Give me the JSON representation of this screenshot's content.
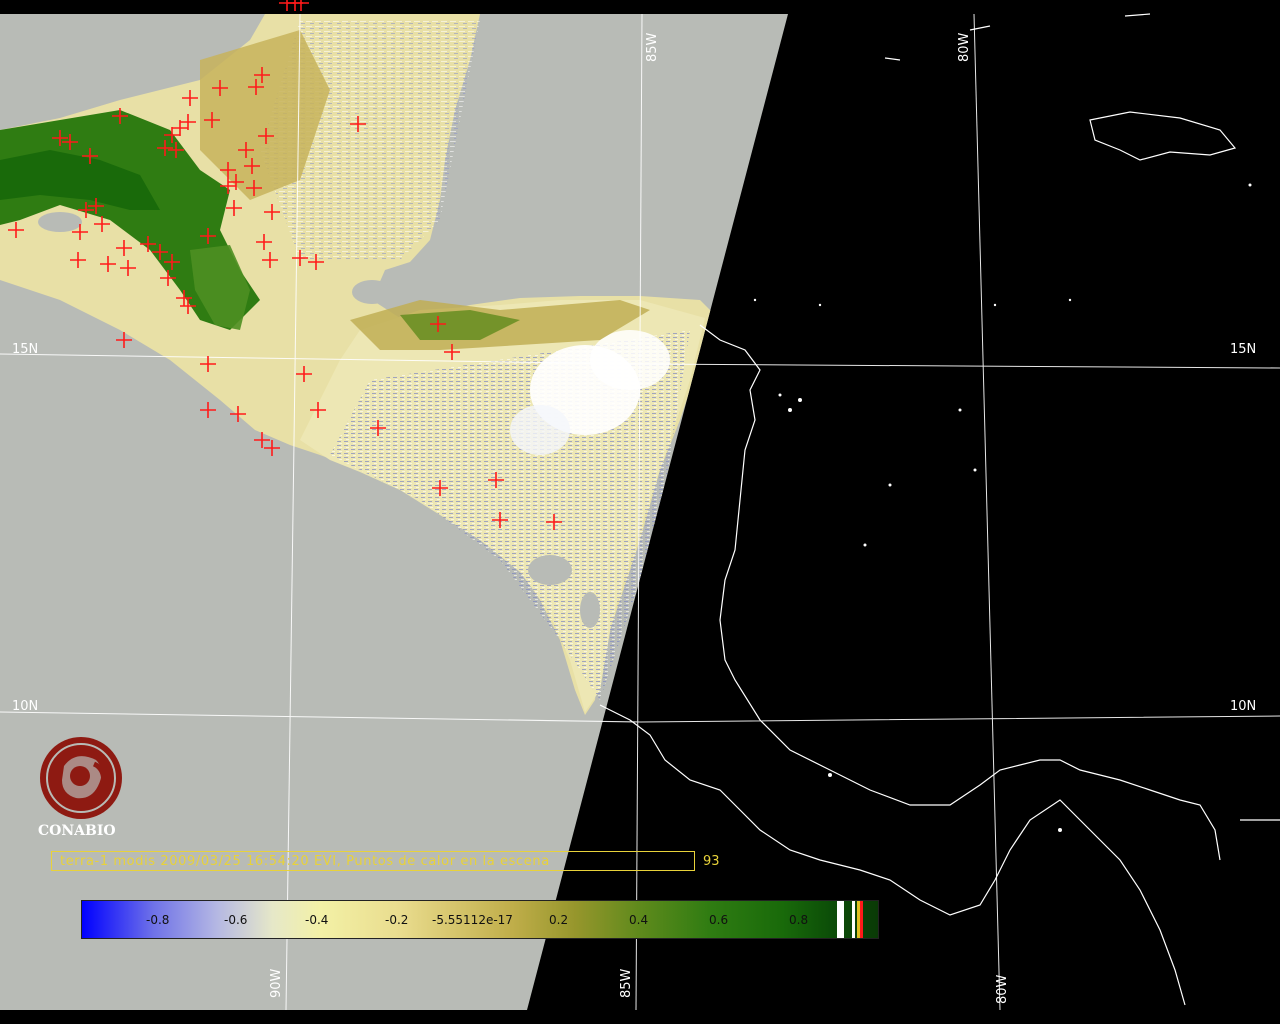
{
  "grid_labels": {
    "lon_85_top": "85W",
    "lon_80_top": "80W",
    "lat_15_left": "15N",
    "lat_15_right": "15N",
    "lat_10_left": "10N",
    "lat_10_right": "10N",
    "lon_90_bottom": "90W",
    "lon_85_bottom": "85W",
    "lon_80_bottom": "80W"
  },
  "logo": {
    "text": "CONABIO"
  },
  "caption": {
    "text": "terra-1 modis 2009/03/25 16:54:20 EVI, Puntos de calor en la escena",
    "count": "93"
  },
  "colorbar": {
    "labels": [
      "-0.8",
      "-0.6",
      "-0.4",
      "-0.2",
      "-5.55112e-17",
      "0.2",
      "0.4",
      "0.6",
      "0.8"
    ]
  },
  "colors": {
    "fire_marker": "#ff1a1a",
    "caption": "#e8d23a",
    "no_data": "#b8bbb6",
    "grid": "#ffffff"
  }
}
